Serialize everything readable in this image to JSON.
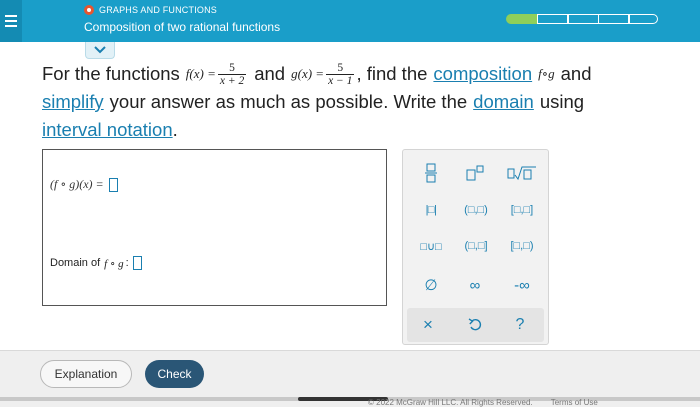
{
  "header": {
    "menu_icon": "hamburger-menu-icon",
    "topic": "GRAPHS AND FUNCTIONS",
    "subtitle": "Composition of two rational functions",
    "progress": {
      "segments": 5,
      "completed": 1,
      "completed_color": "#8fcf5a"
    },
    "collapse_icon": "chevron-down-icon"
  },
  "problem": {
    "t1": "For the functions",
    "f_def": "f(x) =",
    "f_num": "5",
    "f_den": "x + 2",
    "t2": "and",
    "g_def": "g(x) =",
    "g_num": "5",
    "g_den": "x − 1",
    "t3": ", find the",
    "link_composition": "composition",
    "fg": "f∘g",
    "t4": "and",
    "link_simplify": "simplify",
    "t5": "your answer as much as possible. Write the",
    "link_domain": "domain",
    "t6": "using",
    "link_interval": "interval notation",
    "t7": "."
  },
  "answer": {
    "expr_label": "(f ∘ g)(x) =",
    "expr_value": "",
    "domain_label": "Domain of",
    "domain_fg": "f ∘ g",
    "domain_colon": ":",
    "domain_value": ""
  },
  "keypad": {
    "keys": {
      "fraction": "fraction-key-icon",
      "exponent": "exponent-key-icon",
      "sqrt": "square-root-key-icon",
      "abs": "|□|",
      "open_open": "(□,□)",
      "closed_closed": "[□,□]",
      "union": "□∪□",
      "open_closed": "(□,□]",
      "closed_open": "[□,□)",
      "empty_set": "∅",
      "infinity": "∞",
      "neg_infinity": "-∞"
    },
    "actions": {
      "clear": "×",
      "undo": "undo-icon",
      "help": "?"
    },
    "accent_color": "#1a7fb0"
  },
  "footer": {
    "explanation": "Explanation",
    "check": "Check",
    "copyright": "© 2022 McGraw Hill LLC. All Rights Reserved.",
    "terms": "Terms of Use",
    "check_color": "#2a5676"
  }
}
